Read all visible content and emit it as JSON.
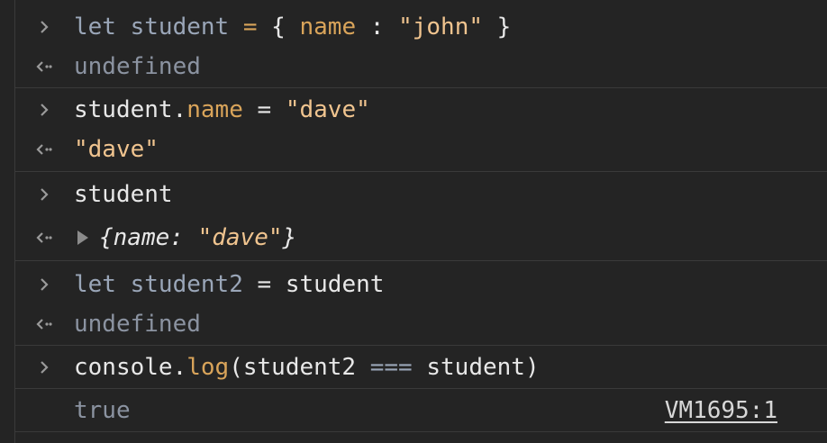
{
  "console": {
    "entries": [
      {
        "input": {
          "kw": "let",
          "var": "student",
          "eq": "=",
          "open": "{",
          "prop": "name",
          "colon": ":",
          "val": "\"john\"",
          "close": "}"
        },
        "output": "undefined"
      },
      {
        "input": {
          "obj": "student.",
          "prop": "name",
          "eq": " = ",
          "val": "\"dave\""
        },
        "output": "\"dave\""
      },
      {
        "input": {
          "text": "student"
        },
        "output": {
          "open": "{",
          "key": "name: ",
          "val": "\"dave\"",
          "close": "}"
        }
      },
      {
        "input": {
          "kw": "let",
          "var": "student2",
          "eq": "=",
          "rhs": "student"
        },
        "output": "undefined"
      },
      {
        "input": {
          "obj": "console.",
          "method": "log",
          "open": "(",
          "arg1": "student2",
          "op": "===",
          "arg2": "student",
          "close": ")"
        },
        "output": "true",
        "source_link": "VM1695:1"
      }
    ]
  },
  "colors": {
    "background": "#242424",
    "separator": "#3a3a3a",
    "keyword": "#9aa6b8",
    "property": "#d9a45a",
    "string": "#f0c48f",
    "text": "#e8e8e8"
  },
  "icons": {
    "prompt": "chevron-right-icon",
    "result": "return-arrow-icon",
    "expand": "triangle-right-icon"
  }
}
